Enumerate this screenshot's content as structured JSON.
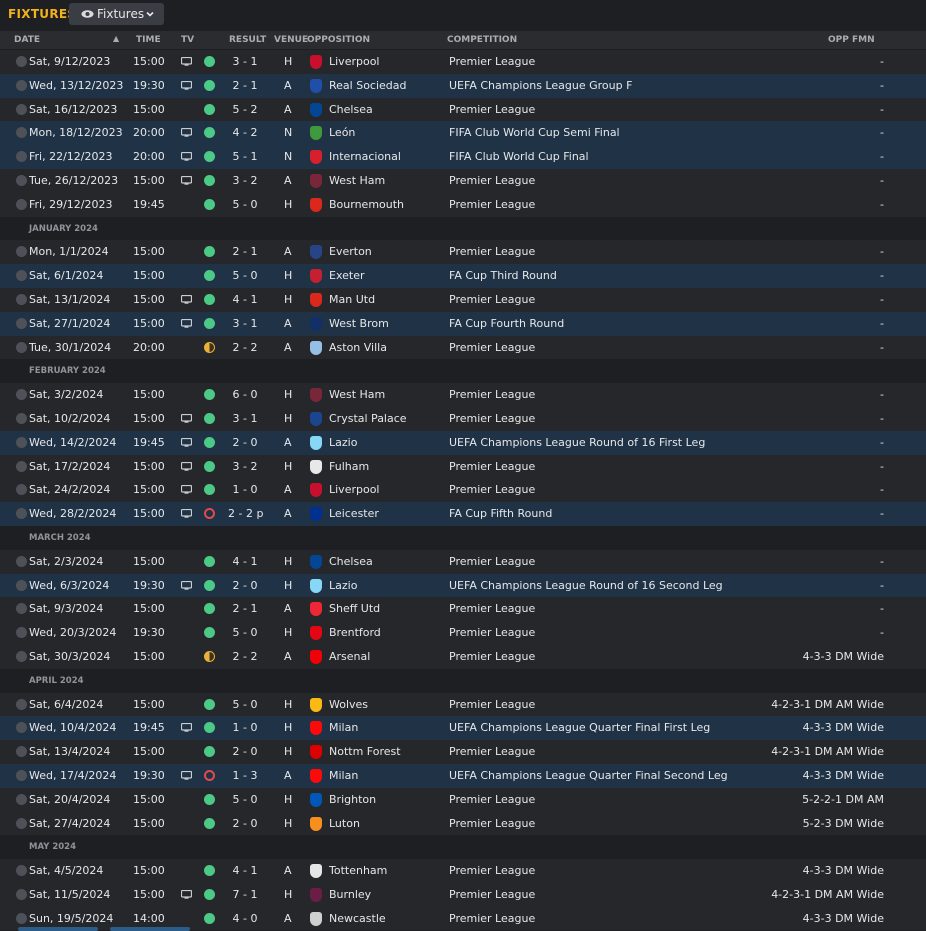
{
  "title": "FIXTURES",
  "view_dropdown": {
    "label": "Fixtures"
  },
  "columns": {
    "date": "DATE",
    "time": "TIME",
    "tv": "TV",
    "result": "RESULT",
    "venue": "VENUE",
    "opposition": "OPPOSITION",
    "competition": "COMPETITION",
    "opp_fmn": "OPP FMN"
  },
  "colors": {
    "accent": "#f2b21b",
    "win": "#4cc986",
    "draw": "#e9b13b",
    "loss": "#e24a4f",
    "highlight_row": "#203245"
  },
  "rows": [
    {
      "kind": "game",
      "date": "Sat, 9/12/2023",
      "time": "15:00",
      "tv": true,
      "outcome": "win",
      "result": "3 - 1",
      "venue": "H",
      "opp": "Liverpool",
      "crest": "#c8102e",
      "comp": "Premier League",
      "fmn": "-",
      "hl": false
    },
    {
      "kind": "game",
      "date": "Wed, 13/12/2023",
      "time": "19:30",
      "tv": true,
      "outcome": "win",
      "result": "2 - 1",
      "venue": "A",
      "opp": "Real Sociedad",
      "crest": "#1f4fa8",
      "comp": "UEFA Champions League Group F",
      "fmn": "-",
      "hl": true
    },
    {
      "kind": "game",
      "date": "Sat, 16/12/2023",
      "time": "15:00",
      "tv": false,
      "outcome": "win",
      "result": "5 - 2",
      "venue": "A",
      "opp": "Chelsea",
      "crest": "#034694",
      "comp": "Premier League",
      "fmn": "-",
      "hl": false
    },
    {
      "kind": "game",
      "date": "Mon, 18/12/2023",
      "time": "20:00",
      "tv": true,
      "outcome": "win",
      "result": "4 - 2",
      "venue": "N",
      "opp": "León",
      "crest": "#3e9a3c",
      "comp": "FIFA Club World Cup Semi Final",
      "fmn": "-",
      "hl": true
    },
    {
      "kind": "game",
      "date": "Fri, 22/12/2023",
      "time": "20:00",
      "tv": true,
      "outcome": "win",
      "result": "5 - 1",
      "venue": "N",
      "opp": "Internacional",
      "crest": "#d8202c",
      "comp": "FIFA Club World Cup Final",
      "fmn": "-",
      "hl": true
    },
    {
      "kind": "game",
      "date": "Tue, 26/12/2023",
      "time": "15:00",
      "tv": true,
      "outcome": "win",
      "result": "3 - 2",
      "venue": "A",
      "opp": "West Ham",
      "crest": "#7a263a",
      "comp": "Premier League",
      "fmn": "-",
      "hl": false
    },
    {
      "kind": "game",
      "date": "Fri, 29/12/2023",
      "time": "19:45",
      "tv": false,
      "outcome": "win",
      "result": "5 - 0",
      "venue": "H",
      "opp": "Bournemouth",
      "crest": "#da291c",
      "comp": "Premier League",
      "fmn": "-",
      "hl": false
    },
    {
      "kind": "month",
      "label": "JANUARY 2024"
    },
    {
      "kind": "game",
      "date": "Mon, 1/1/2024",
      "time": "15:00",
      "tv": false,
      "outcome": "win",
      "result": "2 - 1",
      "venue": "A",
      "opp": "Everton",
      "crest": "#274488",
      "comp": "Premier League",
      "fmn": "-",
      "hl": false
    },
    {
      "kind": "game",
      "date": "Sat, 6/1/2024",
      "time": "15:00",
      "tv": false,
      "outcome": "win",
      "result": "5 - 0",
      "venue": "H",
      "opp": "Exeter",
      "crest": "#c42030",
      "comp": "FA Cup Third Round",
      "fmn": "-",
      "hl": true
    },
    {
      "kind": "game",
      "date": "Sat, 13/1/2024",
      "time": "15:00",
      "tv": true,
      "outcome": "win",
      "result": "4 - 1",
      "venue": "H",
      "opp": "Man Utd",
      "crest": "#da291c",
      "comp": "Premier League",
      "fmn": "-",
      "hl": false
    },
    {
      "kind": "game",
      "date": "Sat, 27/1/2024",
      "time": "15:00",
      "tv": true,
      "outcome": "win",
      "result": "3 - 1",
      "venue": "A",
      "opp": "West Brom",
      "crest": "#122f67",
      "comp": "FA Cup Fourth Round",
      "fmn": "-",
      "hl": true
    },
    {
      "kind": "game",
      "date": "Tue, 30/1/2024",
      "time": "20:00",
      "tv": false,
      "outcome": "draw",
      "result": "2 - 2",
      "venue": "A",
      "opp": "Aston Villa",
      "crest": "#95bfe5",
      "comp": "Premier League",
      "fmn": "-",
      "hl": false
    },
    {
      "kind": "month",
      "label": "FEBRUARY 2024"
    },
    {
      "kind": "game",
      "date": "Sat, 3/2/2024",
      "time": "15:00",
      "tv": false,
      "outcome": "win",
      "result": "6 - 0",
      "venue": "H",
      "opp": "West Ham",
      "crest": "#7a263a",
      "comp": "Premier League",
      "fmn": "-",
      "hl": false
    },
    {
      "kind": "game",
      "date": "Sat, 10/2/2024",
      "time": "15:00",
      "tv": true,
      "outcome": "win",
      "result": "3 - 1",
      "venue": "H",
      "opp": "Crystal Palace",
      "crest": "#1b458f",
      "comp": "Premier League",
      "fmn": "-",
      "hl": false
    },
    {
      "kind": "game",
      "date": "Wed, 14/2/2024",
      "time": "19:45",
      "tv": true,
      "outcome": "win",
      "result": "2 - 0",
      "venue": "A",
      "opp": "Lazio",
      "crest": "#87d8f7",
      "comp": "UEFA Champions League Round of 16 First Leg",
      "fmn": "-",
      "hl": true
    },
    {
      "kind": "game",
      "date": "Sat, 17/2/2024",
      "time": "15:00",
      "tv": true,
      "outcome": "win",
      "result": "3 - 2",
      "venue": "H",
      "opp": "Fulham",
      "crest": "#e8e8e8",
      "comp": "Premier League",
      "fmn": "-",
      "hl": false
    },
    {
      "kind": "game",
      "date": "Sat, 24/2/2024",
      "time": "15:00",
      "tv": true,
      "outcome": "win",
      "result": "1 - 0",
      "venue": "A",
      "opp": "Liverpool",
      "crest": "#c8102e",
      "comp": "Premier League",
      "fmn": "-",
      "hl": false
    },
    {
      "kind": "game",
      "date": "Wed, 28/2/2024",
      "time": "15:00",
      "tv": true,
      "outcome": "loss",
      "result": "2 - 2 p",
      "venue": "A",
      "opp": "Leicester",
      "crest": "#003090",
      "comp": "FA Cup Fifth Round",
      "fmn": "-",
      "hl": true
    },
    {
      "kind": "month",
      "label": "MARCH 2024"
    },
    {
      "kind": "game",
      "date": "Sat, 2/3/2024",
      "time": "15:00",
      "tv": false,
      "outcome": "win",
      "result": "4 - 1",
      "venue": "H",
      "opp": "Chelsea",
      "crest": "#034694",
      "comp": "Premier League",
      "fmn": "-",
      "hl": false
    },
    {
      "kind": "game",
      "date": "Wed, 6/3/2024",
      "time": "19:30",
      "tv": true,
      "outcome": "win",
      "result": "2 - 0",
      "venue": "H",
      "opp": "Lazio",
      "crest": "#87d8f7",
      "comp": "UEFA Champions League Round of 16 Second Leg",
      "fmn": "-",
      "hl": true
    },
    {
      "kind": "game",
      "date": "Sat, 9/3/2024",
      "time": "15:00",
      "tv": false,
      "outcome": "win",
      "result": "2 - 1",
      "venue": "A",
      "opp": "Sheff Utd",
      "crest": "#ee2737",
      "comp": "Premier League",
      "fmn": "-",
      "hl": false
    },
    {
      "kind": "game",
      "date": "Wed, 20/3/2024",
      "time": "19:30",
      "tv": false,
      "outcome": "win",
      "result": "5 - 0",
      "venue": "H",
      "opp": "Brentford",
      "crest": "#e30613",
      "comp": "Premier League",
      "fmn": "-",
      "hl": false
    },
    {
      "kind": "game",
      "date": "Sat, 30/3/2024",
      "time": "15:00",
      "tv": false,
      "outcome": "draw",
      "result": "2 - 2",
      "venue": "A",
      "opp": "Arsenal",
      "crest": "#ef0107",
      "comp": "Premier League",
      "fmn": "4-3-3 DM Wide",
      "hl": false
    },
    {
      "kind": "month",
      "label": "APRIL 2024"
    },
    {
      "kind": "game",
      "date": "Sat, 6/4/2024",
      "time": "15:00",
      "tv": false,
      "outcome": "win",
      "result": "5 - 0",
      "venue": "H",
      "opp": "Wolves",
      "crest": "#fdb913",
      "comp": "Premier League",
      "fmn": "4-2-3-1 DM AM Wide",
      "hl": false
    },
    {
      "kind": "game",
      "date": "Wed, 10/4/2024",
      "time": "19:45",
      "tv": true,
      "outcome": "win",
      "result": "1 - 0",
      "venue": "H",
      "opp": "Milan",
      "crest": "#fb090b",
      "comp": "UEFA Champions League Quarter Final First Leg",
      "fmn": "4-3-3 DM Wide",
      "hl": true
    },
    {
      "kind": "game",
      "date": "Sat, 13/4/2024",
      "time": "15:00",
      "tv": false,
      "outcome": "win",
      "result": "2 - 0",
      "venue": "H",
      "opp": "Nottm Forest",
      "crest": "#dd0000",
      "comp": "Premier League",
      "fmn": "4-2-3-1 DM AM Wide",
      "hl": false
    },
    {
      "kind": "game",
      "date": "Wed, 17/4/2024",
      "time": "19:30",
      "tv": true,
      "outcome": "loss",
      "result": "1 - 3",
      "venue": "A",
      "opp": "Milan",
      "crest": "#fb090b",
      "comp": "UEFA Champions League Quarter Final Second Leg",
      "fmn": "4-3-3 DM Wide",
      "hl": true
    },
    {
      "kind": "game",
      "date": "Sat, 20/4/2024",
      "time": "15:00",
      "tv": false,
      "outcome": "win",
      "result": "5 - 0",
      "venue": "H",
      "opp": "Brighton",
      "crest": "#0057b8",
      "comp": "Premier League",
      "fmn": "5-2-2-1 DM AM",
      "hl": false
    },
    {
      "kind": "game",
      "date": "Sat, 27/4/2024",
      "time": "15:00",
      "tv": false,
      "outcome": "win",
      "result": "2 - 0",
      "venue": "H",
      "opp": "Luton",
      "crest": "#f78f1e",
      "comp": "Premier League",
      "fmn": "5-2-3 DM Wide",
      "hl": false
    },
    {
      "kind": "month",
      "label": "MAY 2024"
    },
    {
      "kind": "game",
      "date": "Sat, 4/5/2024",
      "time": "15:00",
      "tv": false,
      "outcome": "win",
      "result": "4 - 1",
      "venue": "A",
      "opp": "Tottenham",
      "crest": "#e6e6e6",
      "comp": "Premier League",
      "fmn": "4-3-3 DM Wide",
      "hl": false
    },
    {
      "kind": "game",
      "date": "Sat, 11/5/2024",
      "time": "15:00",
      "tv": true,
      "outcome": "win",
      "result": "7 - 1",
      "venue": "H",
      "opp": "Burnley",
      "crest": "#6c1d45",
      "comp": "Premier League",
      "fmn": "4-2-3-1 DM AM Wide",
      "hl": false
    },
    {
      "kind": "game",
      "date": "Sun, 19/5/2024",
      "time": "14:00",
      "tv": false,
      "outcome": "win",
      "result": "4 - 0",
      "venue": "A",
      "opp": "Newcastle",
      "crest": "#d0d0d0",
      "comp": "Premier League",
      "fmn": "4-3-3 DM Wide",
      "hl": false
    }
  ]
}
